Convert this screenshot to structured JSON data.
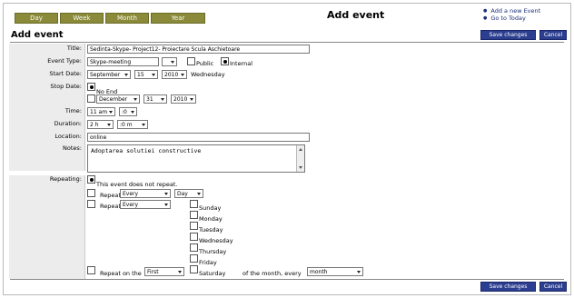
{
  "nav": {
    "tabs": [
      {
        "label": "Day"
      },
      {
        "label": "Week"
      },
      {
        "label": "Month"
      },
      {
        "label": "Year"
      }
    ],
    "header_title": "Add event",
    "quick_links": [
      "Add a new Event",
      "Go to Today"
    ]
  },
  "page_title": "Add event",
  "buttons": {
    "save": "Save changes",
    "cancel": "Cancel"
  },
  "form": {
    "title_label": "Title:",
    "title_value": "Sedinta-Skype- Project12- Proiectare Scula Aschietoare",
    "event_type_label": "Event Type:",
    "event_type_value": "Skype-meeting",
    "public_label": "Public",
    "internal_label": "Internal",
    "start_date_label": "Start Date:",
    "start_month": "September",
    "start_day": "15",
    "start_year": "2010",
    "start_weekday": "Wednesday",
    "stop_date_label": "Stop Date:",
    "no_end_label": "No End",
    "stop_month": "December",
    "stop_day": "31",
    "stop_year": "2010",
    "time_label": "Time:",
    "time_hour": "11 am",
    "time_min": ":0",
    "duration_label": "Duration:",
    "duration_hours": "2 h",
    "duration_min": ":0 m",
    "location_label": "Location:",
    "location_value": "online",
    "notes_label": "Notes:",
    "notes_value": "Adoptarea solutiei constructive",
    "repeating_label": "Repeating:",
    "no_repeat_text": "This event does not repeat.",
    "repeat_label": "Repeat",
    "repeat_every_1": "Every",
    "repeat_unit": "Day",
    "repeat_every_2": "Every",
    "weekdays": [
      "Sunday",
      "Monday",
      "Tuesday",
      "Wednesday",
      "Thursday",
      "Friday",
      "Saturday"
    ],
    "repeat_on_label": "Repeat on the",
    "repeat_on_value": "First",
    "of_month_text": "of the month, every",
    "month_value": "month"
  },
  "colors": {
    "nav_tab": "#8a8a3a",
    "button": "#2c3e8f",
    "link": "#1e2f7a"
  }
}
